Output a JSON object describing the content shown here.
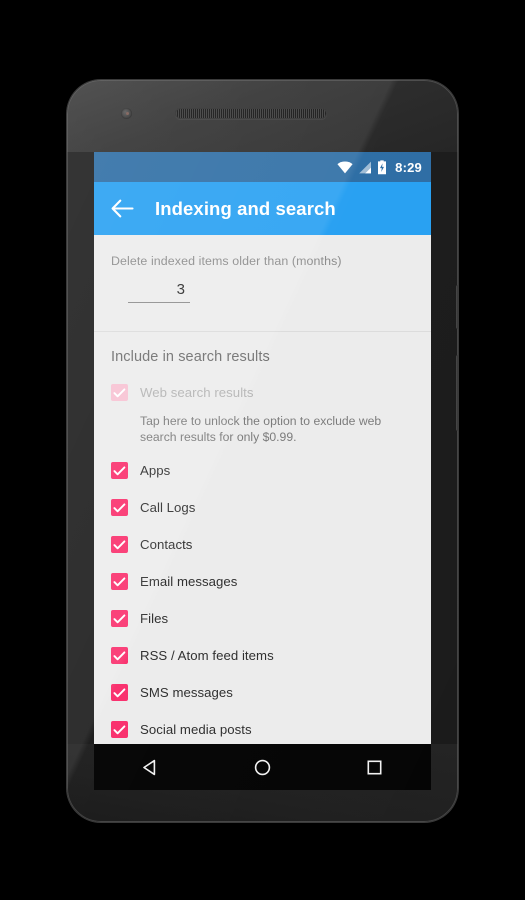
{
  "device": {
    "frame_color": "#1b1b1b",
    "components": {
      "front_camera": "front-camera",
      "earpiece_speaker": "earpiece-grille",
      "bottom_speaker": "bottom-speaker-grille",
      "power_button": "power-button",
      "volume_button": "volume-button"
    }
  },
  "status_bar": {
    "background": "#2d6da4",
    "time": "8:29",
    "icons": {
      "wifi": "wifi-icon",
      "signal": "cellular-signal-icon",
      "battery": "battery-charging-icon"
    }
  },
  "app_bar": {
    "background": "#27a0f2",
    "back_icon": "back-arrow-icon",
    "title": "Indexing and search"
  },
  "settings": {
    "retention": {
      "label": "Delete indexed items older than (months)",
      "value": "3"
    },
    "section_header": "Include in search results",
    "accent_checked": "#f9306d",
    "accent_disabled": "#f7c2d3",
    "items": [
      {
        "label": "Web search results",
        "checked": true,
        "enabled": false,
        "icon": "checkbox-checked-icon"
      },
      {
        "label": "Apps",
        "checked": true,
        "enabled": true,
        "icon": "checkbox-checked-icon"
      },
      {
        "label": "Call Logs",
        "checked": true,
        "enabled": true,
        "icon": "checkbox-checked-icon"
      },
      {
        "label": "Contacts",
        "checked": true,
        "enabled": true,
        "icon": "checkbox-checked-icon"
      },
      {
        "label": "Email messages",
        "checked": true,
        "enabled": true,
        "icon": "checkbox-checked-icon"
      },
      {
        "label": "Files",
        "checked": true,
        "enabled": true,
        "icon": "checkbox-checked-icon"
      },
      {
        "label": "RSS / Atom feed items",
        "checked": true,
        "enabled": true,
        "icon": "checkbox-checked-icon"
      },
      {
        "label": "SMS messages",
        "checked": true,
        "enabled": true,
        "icon": "checkbox-checked-icon"
      },
      {
        "label": "Social media posts",
        "checked": true,
        "enabled": true,
        "icon": "checkbox-checked-icon"
      }
    ],
    "web_search_helper": "Tap here to unlock the option to exclude web search results for only $0.99."
  },
  "nav_bar": {
    "background": "#050505",
    "buttons": [
      {
        "name": "back-nav-button",
        "icon": "triangle-back-icon"
      },
      {
        "name": "home-nav-button",
        "icon": "circle-home-icon"
      },
      {
        "name": "recents-nav-button",
        "icon": "square-recents-icon"
      }
    ]
  }
}
